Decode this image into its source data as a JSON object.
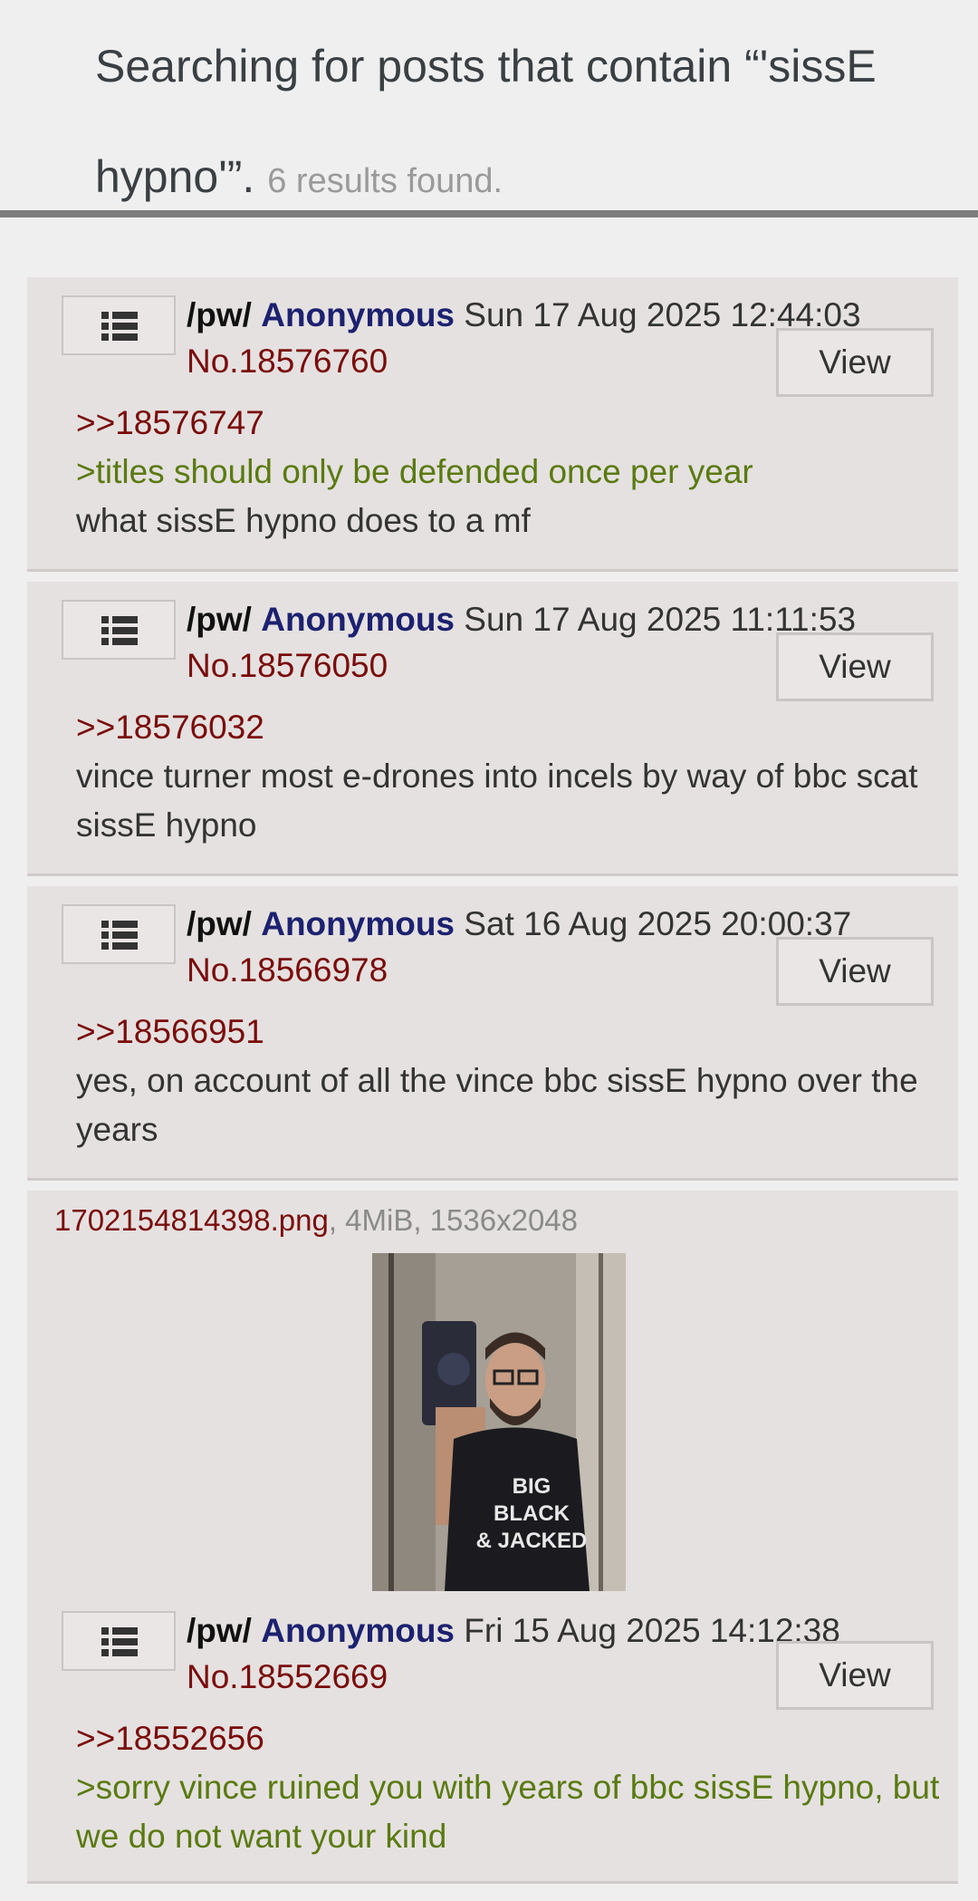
{
  "header": {
    "search_text": "Searching for posts that contain “'sissE hypno'”.",
    "results_count": "6 results found."
  },
  "posts": [
    {
      "board": "/pw/",
      "name": "Anonymous",
      "date": "Sun 17 Aug 2025 12:44:03",
      "number": "No.18576760",
      "view_label": "View",
      "quote_link": ">>18576747",
      "greentext": ">titles should only be defended once per year",
      "text": "what sissE hypno does to a mf"
    },
    {
      "board": "/pw/",
      "name": "Anonymous",
      "date": "Sun 17 Aug 2025 11:11:53",
      "number": "No.18576050",
      "view_label": "View",
      "quote_link": ">>18576032",
      "text": "vince turner most e-drones into incels by way of bbc scat sissE hypno"
    },
    {
      "board": "/pw/",
      "name": "Anonymous",
      "date": "Sat 16 Aug 2025 20:00:37",
      "number": "No.18566978",
      "view_label": "View",
      "quote_link": ">>18566951",
      "text": "yes, on account of all the vince bbc sissE hypno over the years"
    },
    {
      "file_name": "1702154814398.png",
      "file_meta": ", 4MiB, 1536x2048",
      "board": "/pw/",
      "name": "Anonymous",
      "date": "Fri 15 Aug 2025 14:12:38",
      "number": "No.18552669",
      "view_label": "View",
      "quote_link": ">>18552656",
      "greentext": ">sorry vince ruined you with years of bbc sissE hypno, but we do not want your kind"
    }
  ],
  "image": {
    "shirt_text": [
      "BIG",
      "BLACK",
      "& JACKED"
    ]
  },
  "icons": {
    "menu": "list-icon"
  },
  "colors": {
    "background": "#efefef",
    "post_bg": "#e5e1e0",
    "name": "#1c2170",
    "post_number": "#7a0b0b",
    "greentext": "#5a7a10"
  }
}
